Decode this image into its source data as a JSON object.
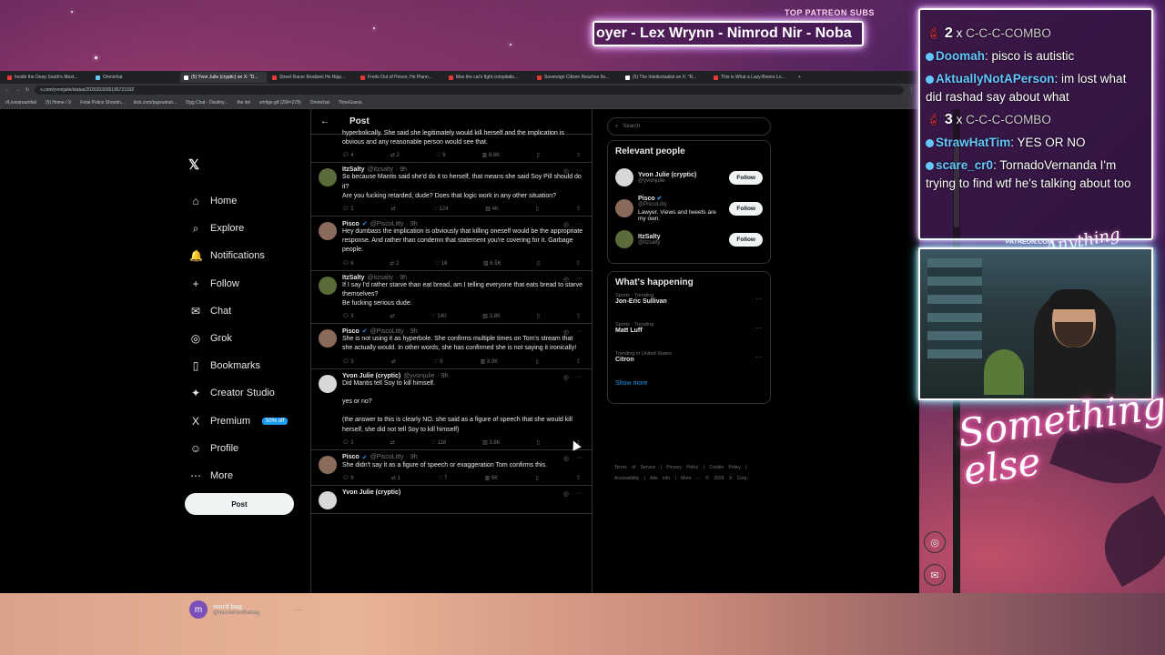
{
  "overlay": {
    "patreon_label": "TOP PATREON SUBS",
    "ticker_text": "oyer - Lex Wrynn - Nimrod Nir - Noba",
    "patreon_small": "PATREON.COM/",
    "neon_small": "Anything else?",
    "neon_big": "Something else",
    "chat": [
      {
        "type": "combo",
        "count": "2",
        "x": "x",
        "text": "C-C-C-COMBO"
      },
      {
        "type": "msg",
        "user": "Doomah",
        "text": "pisco is autistic"
      },
      {
        "type": "msg",
        "user": "AktuallyNotAPerson",
        "text": "im lost what did rashad say about what"
      },
      {
        "type": "combo",
        "count": "3",
        "x": "x",
        "text": "C-C-C-COMBO"
      },
      {
        "type": "msg",
        "user": "StrawHatTim",
        "text": "YES OR NO"
      },
      {
        "type": "msg",
        "user": "scare_cr0",
        "text": "TornadoVernanda I'm trying to find wtf he's talking about too"
      }
    ]
  },
  "browser": {
    "tabs": [
      "Inside the Deep South's Most...",
      "Omnichat",
      "(5) Yvon Julie (cryptic) on X: \"D...",
      "Street Racer Realizes He Ripp...",
      "Freds Out of Prison, He Plann...",
      "Max the cat's fight compilatio...",
      "Sovereign Citizen Reaches Its...",
      "(5) The Intellectualist on X: \"R...",
      "This is What a Lazy-Bones Lo..."
    ],
    "url": "x.com/yvonjulie/status/2026203935195721932",
    "bookmarks": [
      "r/Livestreamfail",
      "(5) Home / X",
      "Fetal Police Shootin...",
      "kick.com/pupoutran...",
      "Dgg Chat - Destiny...",
      "the list",
      "smfige.gif (299×278)",
      "Omnichat",
      "TimeGuess"
    ]
  },
  "sidebar": {
    "items": [
      {
        "icon": "⌂",
        "label": "Home"
      },
      {
        "icon": "⌕",
        "label": "Explore"
      },
      {
        "icon": "🔔",
        "label": "Notifications"
      },
      {
        "icon": "+",
        "label": "Follow"
      },
      {
        "icon": "✉",
        "label": "Chat"
      },
      {
        "icon": "◎",
        "label": "Grok"
      },
      {
        "icon": "▯",
        "label": "Bookmarks"
      },
      {
        "icon": "✦",
        "label": "Creator Studio"
      },
      {
        "icon": "X",
        "label": "Premium"
      },
      {
        "icon": "☺",
        "label": "Profile"
      },
      {
        "icon": "⋯",
        "label": "More"
      }
    ],
    "premium_badge": "50% off",
    "post_button": "Post",
    "account": {
      "initial": "m",
      "name": "murd bag",
      "handle": "@murdersinthebag"
    }
  },
  "timeline": {
    "header": "Post",
    "tweets": [
      {
        "name": "",
        "handle": "",
        "time": "",
        "text": "hyperbolically. She said she legitimately would kill herself and the implication is obvious and any reasonable person would see that.",
        "replies": "4",
        "reposts": "2",
        "likes": "9",
        "views": "6.6K",
        "avatar": "#5a4a3a",
        "verified": false
      },
      {
        "name": "ItzSalty",
        "handle": "@itzsalty",
        "time": "· 9h",
        "text": "So because Mantis said she'd do it to herself, that means she said Soy Pill should do it?\nAre you fucking retarded, dude? Does that logic work in any other situation?",
        "replies": "1",
        "reposts": "",
        "likes": "124",
        "views": "4K",
        "avatar": "#5b6b3a",
        "verified": false
      },
      {
        "name": "Pisco",
        "handle": "@PiscoLitty",
        "time": "· 9h",
        "text": "Hey dumbass the implication is obviously that killing oneself would be the appropriate response. And rather than condemn that statement you're covering for it. Garbage people.",
        "replies": "6",
        "reposts": "2",
        "likes": "16",
        "views": "6.5K",
        "avatar": "#8a6a5a",
        "verified": true
      },
      {
        "name": "ItzSalty",
        "handle": "@itzsalty",
        "time": "· 9h",
        "text": "If I say I'd rather starve than eat bread, am I telling everyone that eats bread to starve themselves?\nBe fucking serious dude.",
        "replies": "3",
        "reposts": "",
        "likes": "140",
        "views": "3.8K",
        "avatar": "#5b6b3a",
        "verified": false
      },
      {
        "name": "Pisco",
        "handle": "@PiscoLitty",
        "time": "· 9h",
        "text": "She is not using it as hyperbole. She confirms multiple times on Tom's stream that she actually would. In other words, she has confirmed she is not saying it ironically!",
        "replies": "3",
        "reposts": "",
        "likes": "9",
        "views": "3.9K",
        "avatar": "#8a6a5a",
        "verified": true
      },
      {
        "name": "Yvon Julie (cryptic)",
        "handle": "@yvonjulie",
        "time": "· 9h",
        "text": "Did Mantis tell Soy to kill himself.\n\nyes or no?\n\n(the answer to this is clearly NO. she said as a figure of speech that she would kill herself, she did not tell Soy to kill himself)",
        "replies": "1",
        "reposts": "",
        "likes": "118",
        "views": "3.8K",
        "avatar": "#d8d8d8",
        "verified": false
      },
      {
        "name": "Pisco",
        "handle": "@PiscoLitty",
        "time": "· 9h",
        "text": "She didn't say it as a figure of speech or exaggeration Tom confirms this.",
        "replies": "9",
        "reposts": "1",
        "likes": "7",
        "views": "6K",
        "avatar": "#8a6a5a",
        "verified": true
      },
      {
        "name": "Yvon Julie (cryptic)",
        "handle": "",
        "time": "",
        "text": "",
        "replies": "",
        "reposts": "",
        "likes": "",
        "views": "",
        "avatar": "#d8d8d8",
        "verified": false
      }
    ]
  },
  "right": {
    "search_placeholder": "Search",
    "relevant_title": "Relevant people",
    "people": [
      {
        "name": "Yvon Julie (cryptic)",
        "handle": "@yvonjulie",
        "bio": "",
        "follow": "Follow",
        "avatar": "#d8d8d8",
        "verified": false
      },
      {
        "name": "Pisco",
        "handle": "@PiscoLitty",
        "bio": "Lawyer. Views and tweets are my own.",
        "follow": "Follow",
        "avatar": "#8a6a5a",
        "verified": true
      },
      {
        "name": "ItzSalty",
        "handle": "@itzsalty",
        "bio": "",
        "follow": "Follow",
        "avatar": "#5b6b3a",
        "verified": false
      }
    ],
    "happening_title": "What's happening",
    "trends": [
      {
        "category": "Sports · Trending",
        "title": "Jon-Eric Sullivan"
      },
      {
        "category": "Sports · Trending",
        "title": "Matt Luff"
      },
      {
        "category": "Trending in United States",
        "title": "Citron"
      }
    ],
    "show_more": "Show more",
    "footer": "Terms of Service  |  Privacy Policy  |  Cookie Policy  |  Accessibility  |  Ads info  |  More ···  © 2026 X Corp."
  }
}
